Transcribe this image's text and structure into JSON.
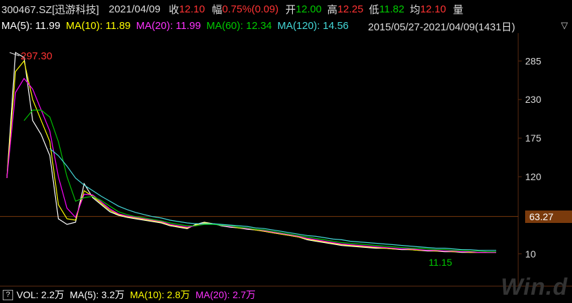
{
  "header": {
    "code": "300467.SZ[迅游科技]",
    "date": "2021/04/09",
    "close_label": "收",
    "close": "12.10",
    "change_label": "幅",
    "change": "0.75%(0.09)",
    "open_label": "开",
    "open": "12.00",
    "high_label": "高",
    "high": "12.25",
    "low_label": "低",
    "low": "11.82",
    "avg_label": "均",
    "avg": "12.10",
    "more_label": "量"
  },
  "ma_bar": {
    "ma5": "MA(5): 11.99",
    "ma10": "MA(10): 11.89",
    "ma20": "MA(20): 11.99",
    "ma60": "MA(60): 12.34",
    "ma120": "MA(120): 14.56",
    "range": "2015/05/27-2021/04/09(1431日)",
    "dropdown_icon": "chevron-down-icon"
  },
  "chart_data": {
    "type": "line",
    "y_ticks": [
      "285",
      "230",
      "175",
      "120",
      "10"
    ],
    "ylim": [
      -5,
      305
    ],
    "max_label": "297.30",
    "min_label": "11.15",
    "last_price_label": "63.27",
    "last_price": 63.27,
    "series": [
      {
        "color": "#ffffff",
        "values": [
          118,
          297,
          290,
          200,
          180,
          150,
          60,
          52,
          55,
          110,
          90,
          80,
          70,
          65,
          62,
          60,
          58,
          56,
          54,
          50,
          48,
          46,
          52,
          55,
          53,
          50,
          48,
          47,
          45,
          44,
          42,
          40,
          38,
          36,
          34,
          30,
          28,
          26,
          24,
          22,
          21,
          20,
          19,
          18,
          18,
          17,
          16,
          16,
          15,
          14,
          14,
          13,
          13,
          12,
          12,
          12,
          12,
          12
        ]
      },
      {
        "color": "#ffff00",
        "values": [
          118,
          270,
          285,
          230,
          200,
          170,
          80,
          60,
          58,
          100,
          92,
          82,
          72,
          66,
          63,
          61,
          59,
          57,
          55,
          51,
          49,
          47,
          51,
          54,
          53,
          51,
          49,
          47,
          46,
          44,
          42,
          40,
          38,
          36,
          34,
          31,
          29,
          27,
          25,
          23,
          22,
          21,
          20,
          19,
          18,
          17,
          17,
          16,
          15,
          15,
          14,
          14,
          13,
          13,
          12,
          12,
          12,
          12
        ]
      },
      {
        "color": "#ff00ff",
        "values": [
          118,
          240,
          260,
          245,
          215,
          185,
          120,
          75,
          62,
          95,
          94,
          84,
          74,
          67,
          64,
          62,
          60,
          58,
          56,
          52,
          50,
          48,
          50,
          53,
          53,
          51,
          49,
          48,
          46,
          45,
          43,
          41,
          39,
          37,
          35,
          32,
          30,
          28,
          26,
          24,
          23,
          22,
          21,
          20,
          19,
          18,
          17,
          17,
          16,
          15,
          15,
          14,
          14,
          13,
          13,
          12,
          12,
          12
        ]
      },
      {
        "color": "#00c000",
        "values": [
          null,
          null,
          200,
          215,
          215,
          205,
          170,
          120,
          85,
          90,
          92,
          86,
          78,
          70,
          66,
          63,
          61,
          59,
          57,
          54,
          52,
          50,
          50,
          52,
          52,
          51,
          50,
          48,
          47,
          45,
          44,
          42,
          40,
          38,
          36,
          34,
          32,
          30,
          28,
          26,
          25,
          24,
          23,
          22,
          21,
          20,
          19,
          18,
          18,
          17,
          16,
          16,
          15,
          15,
          14,
          14,
          13,
          13
        ]
      },
      {
        "color": "#44d8d8",
        "values": [
          null,
          null,
          null,
          null,
          null,
          160,
          150,
          135,
          118,
          108,
          100,
          92,
          85,
          78,
          73,
          69,
          66,
          63,
          61,
          58,
          56,
          54,
          53,
          53,
          53,
          52,
          51,
          50,
          49,
          47,
          46,
          44,
          42,
          40,
          38,
          36,
          35,
          33,
          31,
          30,
          28,
          27,
          26,
          25,
          24,
          23,
          22,
          21,
          20,
          19,
          18,
          18,
          17,
          16,
          16,
          15,
          15,
          15
        ]
      }
    ]
  },
  "volume_bar": {
    "help_label": "?",
    "vol": "VOL: 2.2万",
    "ma5": "MA(5): 3.2万",
    "ma10": "MA(10): 2.8万",
    "ma20": "MA(20): 2.7万"
  },
  "watermark": "Win.d",
  "colors": {
    "red": "#ff3333",
    "green": "#00cc00",
    "yellow": "#ffff00",
    "magenta": "#ff33ff",
    "cyan": "#44d8d8",
    "white": "#ffffff"
  }
}
